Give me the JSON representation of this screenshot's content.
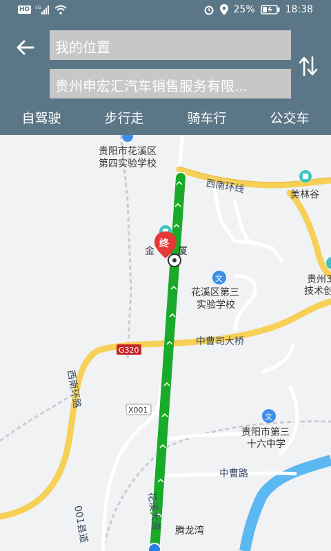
{
  "status": {
    "battery": "25%",
    "time": "18:38",
    "hd_badge": "HD",
    "net_badge": "5G"
  },
  "nav": {
    "from_value": "我的位置",
    "to_value": "贵州申宏汇汽车销售服务有限...",
    "tabs": [
      {
        "label": "自驾驶"
      },
      {
        "label": "步行走"
      },
      {
        "label": "骑车行"
      },
      {
        "label": "公交车"
      }
    ]
  },
  "map": {
    "pois": [
      {
        "line1": "贵阳市花溪区",
        "line2": "第四实验学校"
      },
      {
        "line1": "美林谷",
        "line2": ""
      },
      {
        "line1": "金",
        "line2": "厦"
      },
      {
        "line1": "花溪区第三",
        "line2": "实验学校"
      },
      {
        "line1": "贵州3",
        "line2": "技术创"
      },
      {
        "line1": "贵阳市第三",
        "line2": "十六中学"
      },
      {
        "line1": "腾龙湾",
        "line2": ""
      }
    ],
    "roads": [
      {
        "name": "西南环线"
      },
      {
        "name": "中曹司大桥"
      },
      {
        "name": "G320"
      },
      {
        "name": "西南环路"
      },
      {
        "name": "X001"
      },
      {
        "name": "中曹路"
      },
      {
        "name": "花溪大道"
      },
      {
        "name": "001县道"
      }
    ],
    "destination_marker": "终",
    "colors": {
      "route": "#1aaa2a",
      "highway": "#f6d057",
      "water": "#5bb8f0",
      "header": "#5b7787"
    }
  }
}
